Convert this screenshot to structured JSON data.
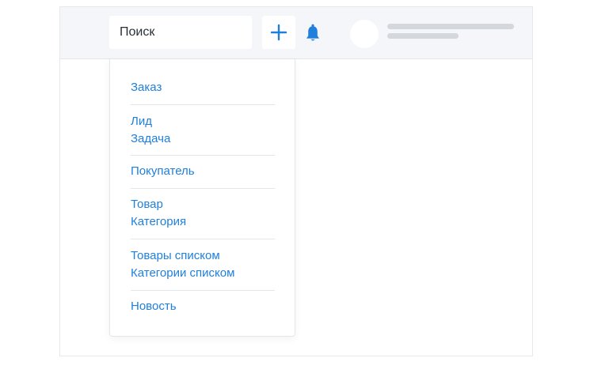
{
  "header": {
    "search": {
      "value": "Поиск"
    },
    "add_button": {
      "icon": "plus-icon",
      "color": "#1f7fdc"
    },
    "notifications": {
      "icon": "bell-icon",
      "color": "#1f7fdc"
    },
    "user": {
      "avatar": "avatar-placeholder"
    }
  },
  "create_menu": {
    "link_color": "#1f7fdc",
    "groups": [
      {
        "items": [
          "Заказ"
        ]
      },
      {
        "items": [
          "Лид",
          "Задача"
        ]
      },
      {
        "items": [
          "Покупатель"
        ]
      },
      {
        "items": [
          "Товар",
          "Категория"
        ]
      },
      {
        "items": [
          "Товары списком",
          "Категории списком"
        ]
      },
      {
        "items": [
          "Новость"
        ]
      }
    ]
  }
}
